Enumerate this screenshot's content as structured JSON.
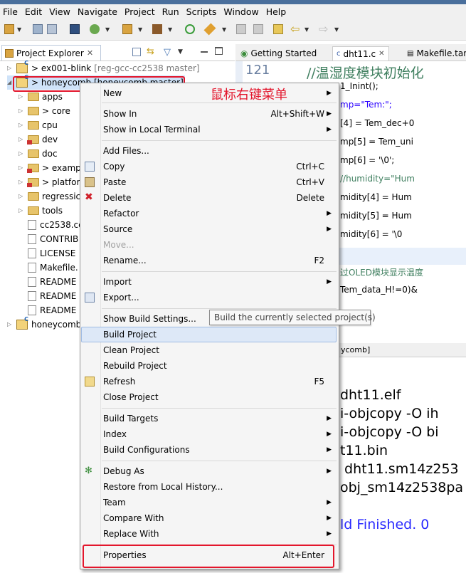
{
  "menubar": [
    "File",
    "Edit",
    "View",
    "Navigate",
    "Project",
    "Run",
    "Scripts",
    "Window",
    "Help"
  ],
  "project_explorer": {
    "title": "Project Explorer",
    "items": [
      {
        "label": "> ex001-blink",
        "tag": "[reg-gcc-cc2538 master]"
      },
      {
        "label": "> honeycomb [honeycomb master]"
      },
      {
        "label": "apps"
      },
      {
        "label": "> core"
      },
      {
        "label": "cpu"
      },
      {
        "label": "dev"
      },
      {
        "label": "doc"
      },
      {
        "label": "> examp"
      },
      {
        "label": "> platfor"
      },
      {
        "label": "regressic"
      },
      {
        "label": "tools"
      },
      {
        "label": "cc2538.cc"
      },
      {
        "label": "CONTRIB"
      },
      {
        "label": "LICENSE"
      },
      {
        "label": "Makefile."
      },
      {
        "label": "README"
      },
      {
        "label": "README"
      },
      {
        "label": "README"
      },
      {
        "label": "honeycomb"
      }
    ]
  },
  "editor": {
    "tabs": [
      "Getting Started",
      "dht11.c",
      "Makefile.targ"
    ],
    "line_no": "121",
    "lines": [
      "//温湿度模块初始化",
      "1_Inint();",
      "mp=\"Tem:\";",
      "[4] = Tem_dec+0",
      "mp[5] = Tem_uni",
      "mp[6] = '\\0';",
      "//humidity=\"Hum",
      "midity[4] = Hum",
      "midity[5] = Hum",
      "midity[6] = '\\0",
      "",
      "过OLED模块显示温度",
      "Tem_data_H!=0)&"
    ]
  },
  "console": {
    "header": "ycomb]",
    "lines": [
      "dht11.elf",
      "i-objcopy -O ih",
      "i-objcopy -O bi",
      "t11.bin",
      " dht11.sm14z253",
      "obj_sm14z2538pa",
      "",
      "ld Finished. 0"
    ]
  },
  "context_menu": {
    "items": [
      {
        "label": "New",
        "shortcut": "",
        "arrow": true
      },
      {
        "label": "Show In",
        "shortcut": "Alt+Shift+W",
        "arrow": true
      },
      {
        "label": "Show in Local Terminal",
        "shortcut": "",
        "arrow": true
      },
      {
        "label": "Add Files...",
        "shortcut": ""
      },
      {
        "label": "Copy",
        "shortcut": "Ctrl+C"
      },
      {
        "label": "Paste",
        "shortcut": "Ctrl+V"
      },
      {
        "label": "Delete",
        "shortcut": "Delete"
      },
      {
        "label": "Refactor",
        "shortcut": "",
        "arrow": true
      },
      {
        "label": "Source",
        "shortcut": "",
        "arrow": true
      },
      {
        "label": "Move...",
        "shortcut": "",
        "disabled": true
      },
      {
        "label": "Rename...",
        "shortcut": "F2"
      },
      {
        "label": "Import",
        "shortcut": "",
        "arrow": true
      },
      {
        "label": "Export...",
        "shortcut": ""
      },
      {
        "label": "Show Build Settings...",
        "shortcut": ""
      },
      {
        "label": "Build Project",
        "shortcut": "",
        "highlighted": true
      },
      {
        "label": "Clean Project",
        "shortcut": ""
      },
      {
        "label": "Rebuild Project",
        "shortcut": ""
      },
      {
        "label": "Refresh",
        "shortcut": "F5"
      },
      {
        "label": "Close Project",
        "shortcut": ""
      },
      {
        "label": "Build Targets",
        "shortcut": "",
        "arrow": true
      },
      {
        "label": "Index",
        "shortcut": "",
        "arrow": true
      },
      {
        "label": "Build Configurations",
        "shortcut": "",
        "arrow": true
      },
      {
        "label": "Debug As",
        "shortcut": "",
        "arrow": true
      },
      {
        "label": "Restore from Local History...",
        "shortcut": ""
      },
      {
        "label": "Team",
        "shortcut": "",
        "arrow": true
      },
      {
        "label": "Compare With",
        "shortcut": "",
        "arrow": true
      },
      {
        "label": "Replace With",
        "shortcut": "",
        "arrow": true
      },
      {
        "label": "Properties",
        "shortcut": "Alt+Enter"
      }
    ]
  },
  "tooltip": "Build the currently selected project(s)",
  "annotation": "鼠标右键菜单",
  "colors": {
    "annotation": "#e3162c",
    "comment": "#3f7f5f",
    "string": "#2a00ff",
    "keyword": "#7f0055"
  }
}
